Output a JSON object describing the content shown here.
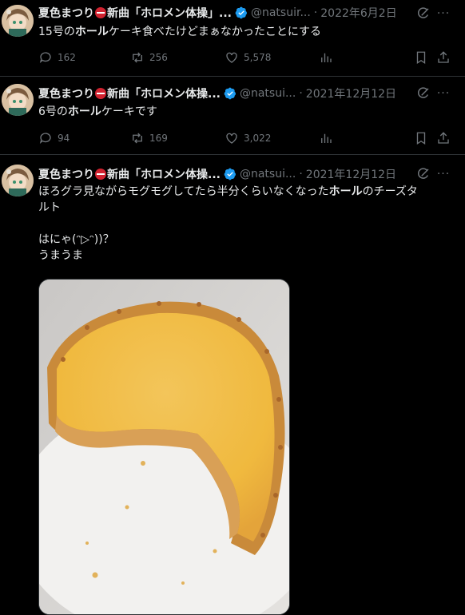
{
  "author": {
    "name": "夏色まつり",
    "name_suffix": "新曲「ホロメン体操」...",
    "name_suffix_short": "新曲「ホロメン体操...",
    "handle_1": "@natsuir...",
    "handle_2": "@natsui...",
    "avatar_icon": "avatar-icon",
    "verified_icon": "verified-badge-icon",
    "verified_color": "#1d9bf0"
  },
  "tweets": [
    {
      "date": "2022年6月2日",
      "text_before": "15号の",
      "text_bold": "ホール",
      "text_after": "ケーキ食べたけどまぁなかったことにする",
      "replies": "162",
      "reposts": "256",
      "likes": "5,578"
    },
    {
      "date": "2021年12月12日",
      "text_before": "6号の",
      "text_bold": "ホール",
      "text_after": "ケーキです",
      "replies": "94",
      "reposts": "169",
      "likes": "3,022"
    },
    {
      "date": "2021年12月12日",
      "text_before": "ほろグラ見ながらモグモグしてたら半分くらいなくなった",
      "text_bold": "ホール",
      "text_after": "のチーズタ\nルト\n\nはにゃ(ᵔ▷ᵔ))？\nうまうま",
      "photo_description_icon": "cheese-tart-photo"
    }
  ],
  "icons": {
    "reply": "reply-icon",
    "repost": "repost-icon",
    "like": "like-icon",
    "views": "views-icon",
    "bookmark": "bookmark-icon",
    "share": "share-icon",
    "grok": "grok-icon",
    "more": "more-icon"
  },
  "colors": {
    "background": "#000000",
    "text": "#e7e9ea",
    "muted": "#71767b",
    "divider": "#2f3336"
  },
  "more_label": "···"
}
